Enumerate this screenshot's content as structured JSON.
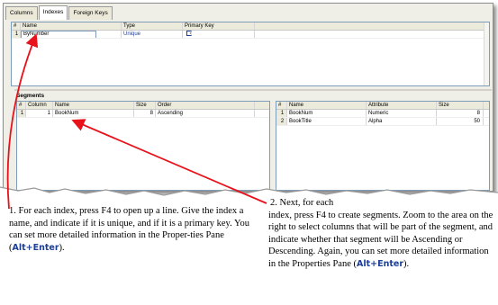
{
  "tabs": [
    "Columns",
    "Indexes",
    "Foreign Keys"
  ],
  "active_tab": "Indexes",
  "indexes_grid": {
    "headers": [
      "#",
      "Name",
      "Type",
      "Primary Key"
    ],
    "rows": [
      {
        "num": "1",
        "name": "ByNumber",
        "type": "Unique",
        "primary_key_checked": true
      }
    ]
  },
  "segments_label": "Segments",
  "segments_grid": {
    "headers": [
      "#",
      "Column",
      "Name",
      "Size",
      "Order"
    ],
    "rows": [
      {
        "num": "1",
        "column": "1",
        "name": "BookNum",
        "size": "8",
        "order": "Ascending"
      }
    ]
  },
  "columns_grid": {
    "headers": [
      "#",
      "Name",
      "Attribute",
      "Size"
    ],
    "rows": [
      {
        "num": "1",
        "name": "BookNum",
        "attribute": "Numeric",
        "size": "8"
      },
      {
        "num": "2",
        "name": "BookTitle",
        "attribute": "Alpha",
        "size": "50"
      }
    ]
  },
  "note1": {
    "text": "1. For each index, press F4 to open up a line. Give the index a name, and indicate if it is unique, and if it is a primary key. You can set more detailed information in the Proper-ties Pane (",
    "key": "Alt+Enter",
    "end": ")."
  },
  "note2": {
    "line1": "2. Next, for each",
    "text": "index, press F4 to create segments. Zoom to the area on the right to select columns that will be part of the segment, and indicate whether that segment will be Ascending or Descending. Again, you can set more detailed information in the Properties Pane (",
    "key": "Alt+Enter",
    "end": ")."
  },
  "colors": {
    "arrow": "#e8121b",
    "link_blue": "#1c3f95",
    "window_bg": "#f0efe7"
  }
}
